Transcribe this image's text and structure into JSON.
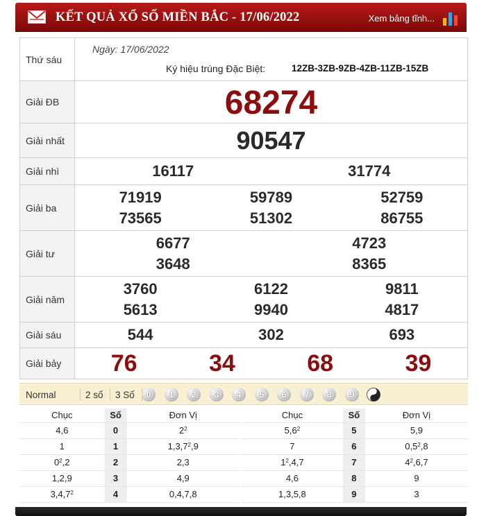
{
  "header": {
    "title": "KẾT QUẢ XỔ SỐ MIỀN BẮC - 17/06/2022",
    "more_link": "Xem bảng tĩnh...",
    "mail_icon": "mail-icon",
    "chart_icon": "bar-chart-icon"
  },
  "info": {
    "weekday": "Thứ sáu",
    "date": "Ngày: 17/06/2022",
    "special_symbol_label": "Ký hiệu trúng Đặc Biệt:",
    "special_symbol_code": "12ZB-3ZB-9ZB-4ZB-11ZB-15ZB"
  },
  "prizes": [
    {
      "label": "Giải ĐB",
      "numbers": [
        "68274"
      ]
    },
    {
      "label": "Giải nhất",
      "numbers": [
        "90547"
      ]
    },
    {
      "label": "Giải nhì",
      "numbers": [
        "16117",
        "31774"
      ]
    },
    {
      "label": "Giải ba",
      "numbers": [
        "71919",
        "59789",
        "52759",
        "73565",
        "51302",
        "86755"
      ]
    },
    {
      "label": "Giải tư",
      "numbers": [
        "6677",
        "4723",
        "3648",
        "8365"
      ]
    },
    {
      "label": "Giải năm",
      "numbers": [
        "3760",
        "6122",
        "9811",
        "5613",
        "9940",
        "4817"
      ]
    },
    {
      "label": "Giải sáu",
      "numbers": [
        "544",
        "302",
        "693"
      ]
    },
    {
      "label": "Giải bảy",
      "numbers": [
        "76",
        "34",
        "68",
        "39"
      ]
    }
  ],
  "filter": {
    "options": [
      "Normal",
      "2 số",
      "3 Số"
    ],
    "balls": [
      "0",
      "1",
      "2",
      "3",
      "4",
      "5",
      "6",
      "7",
      "8",
      "9"
    ],
    "extra_icon": "yin-yang-icon"
  },
  "stats": {
    "headers": {
      "chuc": "Chục",
      "so": "Số",
      "donvi": "Đơn Vị"
    },
    "rows": [
      {
        "chuc": "4,6",
        "so": "0",
        "donvi": "2²",
        "chuc2": "5,6²",
        "so2": "5",
        "donvi2": "5,9"
      },
      {
        "chuc": "1",
        "so": "1",
        "donvi": "1,3,7²,9",
        "chuc2": "7",
        "so2": "6",
        "donvi2": "0,5²,8"
      },
      {
        "chuc": "0²,2",
        "so": "2",
        "donvi": "2,3",
        "chuc2": "1²,4,7",
        "so2": "7",
        "donvi2": "4²,6,7"
      },
      {
        "chuc": "1,2,9",
        "so": "3",
        "donvi": "4,9",
        "chuc2": "4,6",
        "so2": "8",
        "donvi2": "9"
      },
      {
        "chuc": "3,4,7²",
        "so": "4",
        "donvi": "0,4,7,8",
        "chuc2": "1,3,5,8",
        "so2": "9",
        "donvi2": "3"
      }
    ]
  },
  "colors": {
    "header": "#9e1111",
    "special": "#8b0d0d",
    "filter_bg": "#f9efd2"
  }
}
